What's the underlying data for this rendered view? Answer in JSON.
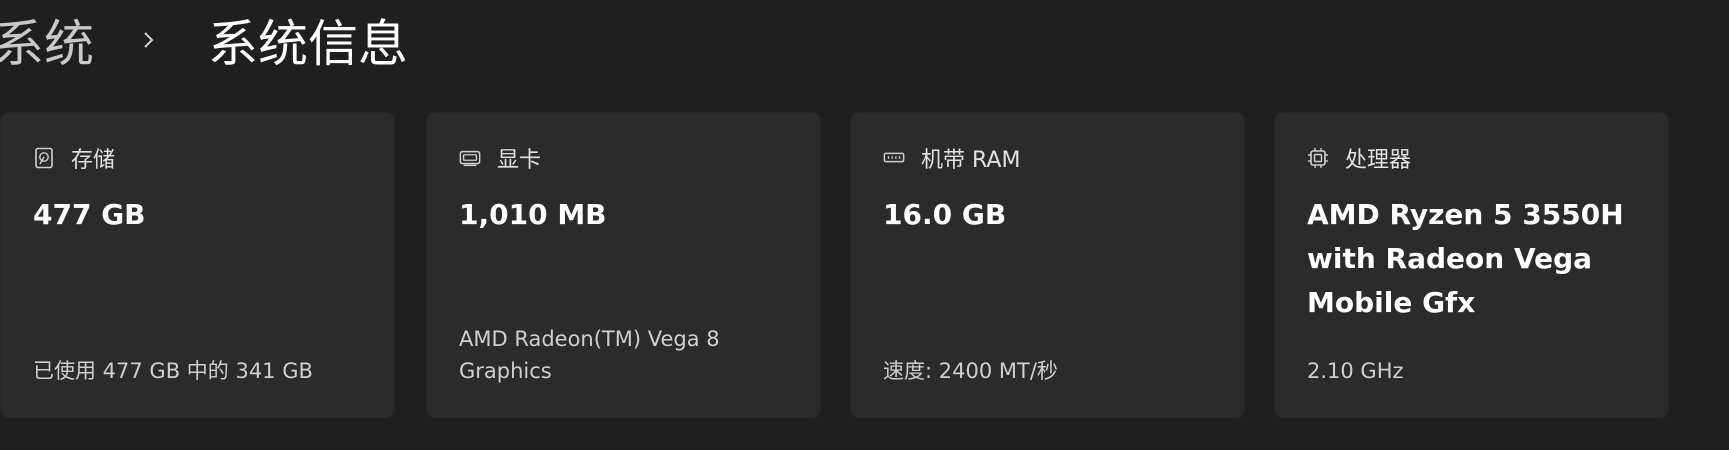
{
  "breadcrumb": {
    "parent": "系统",
    "current": "系统信息"
  },
  "cards": [
    {
      "icon": "storage-icon",
      "title": "存储",
      "value": "477 GB",
      "detail": "已使用 477 GB 中的 341 GB"
    },
    {
      "icon": "gpu-icon",
      "title": "显卡",
      "value": "1,010 MB",
      "detail": "AMD Radeon(TM) Vega 8 Graphics"
    },
    {
      "icon": "ram-icon",
      "title": "机带 RAM",
      "value": "16.0 GB",
      "detail": "速度: 2400 MT/秒"
    },
    {
      "icon": "cpu-icon",
      "title": "处理器",
      "value": "AMD Ryzen 5 3550H with Radeon Vega Mobile Gfx",
      "detail": "2.10 GHz"
    }
  ],
  "colors": {
    "background": "#1f1f1f",
    "card": "#2b2b2b",
    "text_primary": "#ffffff",
    "text_secondary": "#cfcfcf"
  }
}
